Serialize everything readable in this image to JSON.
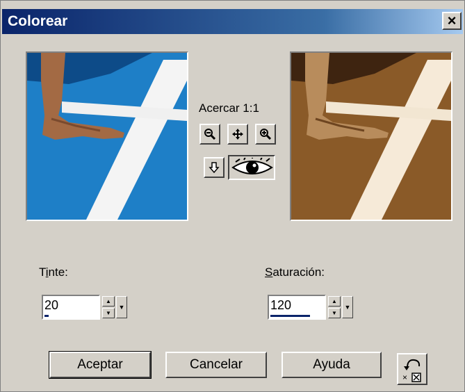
{
  "window": {
    "title": "Colorear",
    "close_label": "×"
  },
  "preview": {
    "before_label": "",
    "after_label": ""
  },
  "zoom": {
    "label": "Acercar 1:1"
  },
  "toolbar": {
    "icons": [
      "zoom-out-icon",
      "pan-icon",
      "zoom-in-icon",
      "arrow-down-icon",
      "eye-icon"
    ]
  },
  "tint": {
    "label_prefix": "T",
    "label_underlined": "i",
    "label_suffix": "nte:",
    "value": "20",
    "bar_fraction": 0.08
  },
  "saturation": {
    "label_prefix": "",
    "label_underlined": "S",
    "label_suffix": "aturación:",
    "value": "120",
    "bar_fraction": 0.75
  },
  "buttons": {
    "ok": "Aceptar",
    "cancel": "Cancelar",
    "help": "Ayuda"
  },
  "colors": {
    "title_bar": "#0a246a",
    "dialog_bg": "#d4d0c8",
    "preview_blue": "#1e7fc7",
    "preview_sepia": "#8a5a28"
  }
}
